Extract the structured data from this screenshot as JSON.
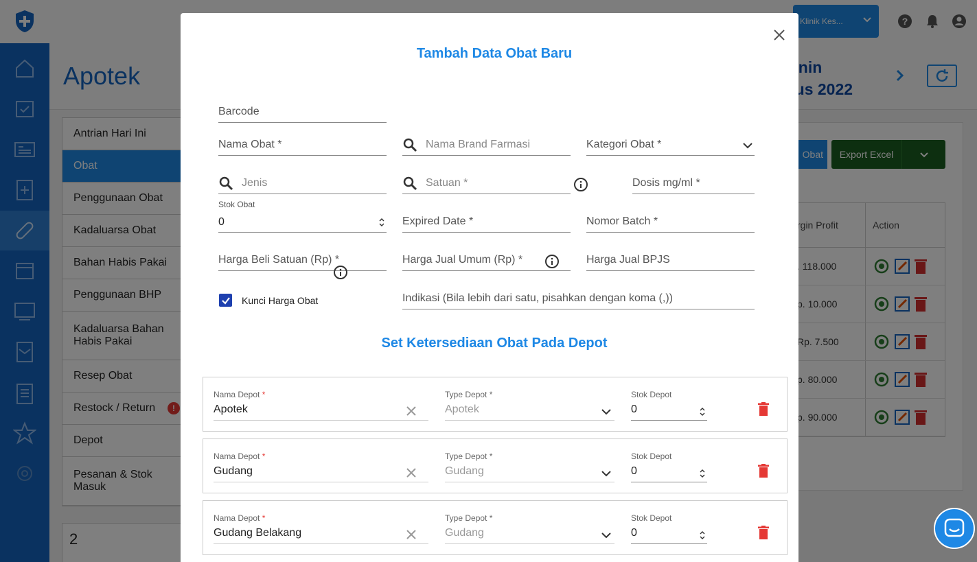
{
  "app": {
    "clinic_select": "Klinik Kes...",
    "page_title": "Apotek",
    "date_line1": "enin",
    "date_line2": "tus 2022",
    "export_button": "Export Excel",
    "obat_button": "Obat",
    "count": "2"
  },
  "menu": [
    {
      "label": "Antrian Hari Ini"
    },
    {
      "label": "Obat"
    },
    {
      "label": "Penggunaan Obat"
    },
    {
      "label": "Kadaluarsa Obat"
    },
    {
      "label": "Bahan Habis Pakai"
    },
    {
      "label": "Penggunaan BHP"
    },
    {
      "label": "Kadaluarsa Bahan Habis Pakai"
    },
    {
      "label": "Resep Obat"
    },
    {
      "label": "Restock / Return"
    },
    {
      "label": "Depot"
    },
    {
      "label": "Pesanan & Stok Masuk"
    }
  ],
  "table": {
    "col_margin": "rgin Profit",
    "col_action": "Action",
    "rows": [
      ". 118.000",
      "p. 10.000",
      "Rp. 7.500",
      "p. 80.000",
      "p. 90.000"
    ]
  },
  "modal": {
    "title": "Tambah Data Obat Baru",
    "barcode": "Barcode",
    "nama_obat": "Nama Obat *",
    "nama_brand": "Nama Brand Farmasi",
    "kategori": "Kategori Obat *",
    "jenis": "Jenis",
    "satuan": "Satuan *",
    "dosis": "Dosis mg/ml *",
    "stok_label": "Stok Obat",
    "stok_value": "0",
    "expired": "Expired Date *",
    "batch": "Nomor Batch *",
    "harga_beli": "Harga Beli Satuan (Rp) *",
    "harga_jual": "Harga Jual Umum (Rp) *",
    "harga_bpjs": "Harga Jual BPJS",
    "kunci_harga": "Kunci Harga Obat",
    "indikasi": "Indikasi (Bila lebih dari satu, pisahkan dengan koma (,))",
    "section_title": "Set Ketersediaan Obat Pada Depot"
  },
  "depots": [
    {
      "nama_label": "Nama Depot",
      "nama": "Apotek",
      "type_label": "Type Depot *",
      "type": "Apotek",
      "stok_label": "Stok Depot",
      "stok": "0"
    },
    {
      "nama_label": "Nama Depot",
      "nama": "Gudang",
      "type_label": "Type Depot *",
      "type": "Gudang",
      "stok_label": "Stok Depot",
      "stok": "0"
    },
    {
      "nama_label": "Nama Depot",
      "nama": "Gudang Belakang",
      "type_label": "Type Depot *",
      "type": "Gudang",
      "stok_label": "Stok Depot",
      "stok": "0"
    }
  ],
  "colors": {
    "accent": "#1e88e5",
    "sidebar": "#1565c0",
    "danger": "#e53935",
    "checkbox": "#1e40af"
  }
}
